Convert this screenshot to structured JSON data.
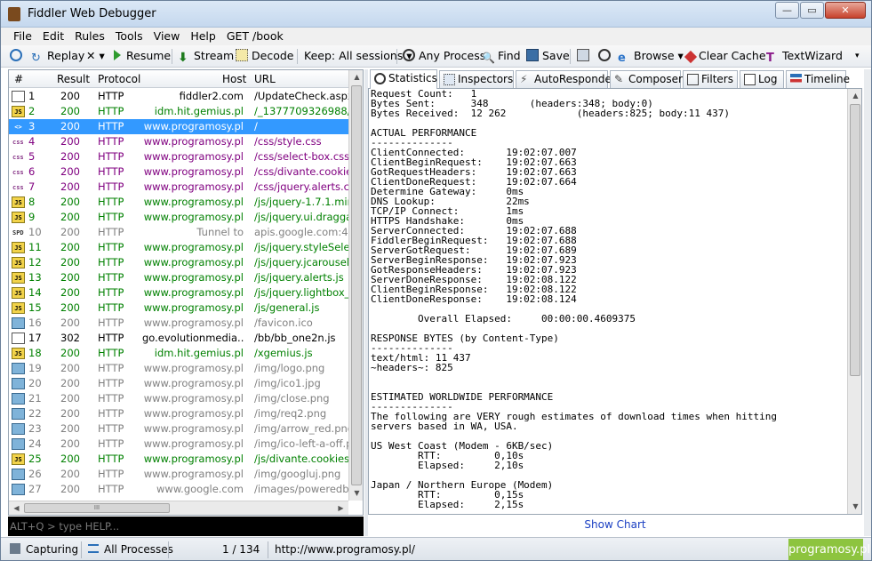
{
  "window": {
    "title": "Fiddler Web Debugger",
    "min_btn": "—",
    "max_btn": "▭",
    "close_btn": "✕"
  },
  "menu": [
    "File",
    "Edit",
    "Rules",
    "Tools",
    "View",
    "Help",
    "GET /book"
  ],
  "toolbar": {
    "comment": "",
    "replay": "Replay",
    "remove": "✕ ▾",
    "resume": "Resume",
    "stream": "Stream",
    "decode": "Decode",
    "keep": "Keep: All sessions ▾",
    "process": "Any Process",
    "find": "Find",
    "save": "Save",
    "browse": "Browse ▾",
    "clear_cache": "Clear Cache",
    "textwizard": "TextWizard"
  },
  "sessions": {
    "headers": {
      "num": "#",
      "result": "Result",
      "protocol": "Protocol",
      "host": "Host",
      "url": "URL"
    },
    "rows": [
      {
        "icon": "doc",
        "num": "1",
        "result": "200",
        "protocol": "HTTP",
        "host": "fiddler2.com",
        "url": "/UpdateCheck.aspx?is",
        "color": "#000000",
        "selected": false
      },
      {
        "icon": "js",
        "num": "2",
        "result": "200",
        "protocol": "HTTP",
        "host": "idm.hit.gemius.pl",
        "url": "/_1377709326988/red",
        "color": "#008000",
        "selected": false
      },
      {
        "icon": "sel",
        "num": "3",
        "result": "200",
        "protocol": "HTTP",
        "host": "www.programosy.pl",
        "url": "/",
        "color": "#ffffff",
        "selected": true
      },
      {
        "icon": "css",
        "num": "4",
        "result": "200",
        "protocol": "HTTP",
        "host": "www.programosy.pl",
        "url": "/css/style.css",
        "color": "#800080",
        "selected": false
      },
      {
        "icon": "css",
        "num": "5",
        "result": "200",
        "protocol": "HTTP",
        "host": "www.programosy.pl",
        "url": "/css/select-box.css",
        "color": "#800080",
        "selected": false
      },
      {
        "icon": "css",
        "num": "6",
        "result": "200",
        "protocol": "HTTP",
        "host": "www.programosy.pl",
        "url": "/css/divante.cookies.r",
        "color": "#800080",
        "selected": false
      },
      {
        "icon": "css",
        "num": "7",
        "result": "200",
        "protocol": "HTTP",
        "host": "www.programosy.pl",
        "url": "/css/jquery.alerts.css",
        "color": "#800080",
        "selected": false
      },
      {
        "icon": "js",
        "num": "8",
        "result": "200",
        "protocol": "HTTP",
        "host": "www.programosy.pl",
        "url": "/js/jquery-1.7.1.min.js",
        "color": "#008000",
        "selected": false
      },
      {
        "icon": "js",
        "num": "9",
        "result": "200",
        "protocol": "HTTP",
        "host": "www.programosy.pl",
        "url": "/js/jquery.ui.draggabl",
        "color": "#008000",
        "selected": false
      },
      {
        "icon": "spdy",
        "num": "10",
        "result": "200",
        "protocol": "HTTP",
        "host": "Tunnel to",
        "url": "apis.google.com:443",
        "color": "#808080",
        "selected": false
      },
      {
        "icon": "js",
        "num": "11",
        "result": "200",
        "protocol": "HTTP",
        "host": "www.programosy.pl",
        "url": "/js/jquery.styleSelect.",
        "color": "#008000",
        "selected": false
      },
      {
        "icon": "js",
        "num": "12",
        "result": "200",
        "protocol": "HTTP",
        "host": "www.programosy.pl",
        "url": "/js/jquery.jcarousel.m",
        "color": "#008000",
        "selected": false
      },
      {
        "icon": "js",
        "num": "13",
        "result": "200",
        "protocol": "HTTP",
        "host": "www.programosy.pl",
        "url": "/js/jquery.alerts.js",
        "color": "#008000",
        "selected": false
      },
      {
        "icon": "js",
        "num": "14",
        "result": "200",
        "protocol": "HTTP",
        "host": "www.programosy.pl",
        "url": "/js/jquery.lightbox_me",
        "color": "#008000",
        "selected": false
      },
      {
        "icon": "js",
        "num": "15",
        "result": "200",
        "protocol": "HTTP",
        "host": "www.programosy.pl",
        "url": "/js/general.js",
        "color": "#008000",
        "selected": false
      },
      {
        "icon": "img",
        "num": "16",
        "result": "200",
        "protocol": "HTTP",
        "host": "www.programosy.pl",
        "url": "/favicon.ico",
        "color": "#808080",
        "selected": false
      },
      {
        "icon": "doc",
        "num": "17",
        "result": "302",
        "protocol": "HTTP",
        "host": "go.evolutionmedia....",
        "url": "/bb/bb_one2n.js",
        "color": "#000000",
        "selected": false
      },
      {
        "icon": "js",
        "num": "18",
        "result": "200",
        "protocol": "HTTP",
        "host": "idm.hit.gemius.pl",
        "url": "/xgemius.js",
        "color": "#008000",
        "selected": false
      },
      {
        "icon": "img",
        "num": "19",
        "result": "200",
        "protocol": "HTTP",
        "host": "www.programosy.pl",
        "url": "/img/logo.png",
        "color": "#808080",
        "selected": false
      },
      {
        "icon": "img",
        "num": "20",
        "result": "200",
        "protocol": "HTTP",
        "host": "www.programosy.pl",
        "url": "/img/ico1.jpg",
        "color": "#808080",
        "selected": false
      },
      {
        "icon": "img",
        "num": "21",
        "result": "200",
        "protocol": "HTTP",
        "host": "www.programosy.pl",
        "url": "/img/close.png",
        "color": "#808080",
        "selected": false
      },
      {
        "icon": "img",
        "num": "22",
        "result": "200",
        "protocol": "HTTP",
        "host": "www.programosy.pl",
        "url": "/img/req2.png",
        "color": "#808080",
        "selected": false
      },
      {
        "icon": "img",
        "num": "23",
        "result": "200",
        "protocol": "HTTP",
        "host": "www.programosy.pl",
        "url": "/img/arrow_red.png",
        "color": "#808080",
        "selected": false
      },
      {
        "icon": "img",
        "num": "24",
        "result": "200",
        "protocol": "HTTP",
        "host": "www.programosy.pl",
        "url": "/img/ico-left-a-off.png",
        "color": "#808080",
        "selected": false
      },
      {
        "icon": "js",
        "num": "25",
        "result": "200",
        "protocol": "HTTP",
        "host": "www.programosy.pl",
        "url": "/js/divante.cookies.mi",
        "color": "#008000",
        "selected": false
      },
      {
        "icon": "img",
        "num": "26",
        "result": "200",
        "protocol": "HTTP",
        "host": "www.programosy.pl",
        "url": "/img/googluj.png",
        "color": "#808080",
        "selected": false
      },
      {
        "icon": "img",
        "num": "27",
        "result": "200",
        "protocol": "HTTP",
        "host": "www.google.com",
        "url": "/images/poweredby_t",
        "color": "#808080",
        "selected": false
      }
    ],
    "hscroll_label": "III"
  },
  "quickexec": {
    "placeholder": "ALT+Q > type HELP..."
  },
  "tabs": [
    "Statistics",
    "Inspectors",
    "AutoResponder",
    "Composer",
    "Filters",
    "Log",
    "Timeline"
  ],
  "statistics": [
    "Request Count:   1",
    "Bytes Sent:      348       (headers:348; body:0)",
    "Bytes Received:  12 262            (headers:825; body:11 437)",
    "",
    "ACTUAL PERFORMANCE",
    "--------------",
    "ClientConnected:       19:02:07.007",
    "ClientBeginRequest:    19:02:07.663",
    "GotRequestHeaders:     19:02:07.663",
    "ClientDoneRequest:     19:02:07.664",
    "Determine Gateway:     0ms",
    "DNS Lookup:            22ms",
    "TCP/IP Connect:        1ms",
    "HTTPS Handshake:       0ms",
    "ServerConnected:       19:02:07.688",
    "FiddlerBeginRequest:   19:02:07.688",
    "ServerGotRequest:      19:02:07.689",
    "ServerBeginResponse:   19:02:07.923",
    "GotResponseHeaders:    19:02:07.923",
    "ServerDoneResponse:    19:02:08.122",
    "ClientBeginResponse:   19:02:08.122",
    "ClientDoneResponse:    19:02:08.124",
    "",
    "        Overall Elapsed:     00:00:00.4609375",
    "",
    "RESPONSE BYTES (by Content-Type)",
    "--------------",
    "text/html: 11 437",
    "~headers~: 825",
    "",
    "",
    "ESTIMATED WORLDWIDE PERFORMANCE",
    "--------------",
    "The following are VERY rough estimates of download times when hitting",
    "servers based in WA, USA.",
    "",
    "US West Coast (Modem - 6KB/sec)",
    "        RTT:         0,10s",
    "        Elapsed:     2,10s",
    "",
    "Japan / Northern Europe (Modem)",
    "        RTT:         0,15s",
    "        Elapsed:     2,15s"
  ],
  "show_chart": "Show Chart",
  "status": {
    "capturing": "Capturing",
    "processes": "All Processes",
    "count": "1 / 134",
    "url": "http://www.programosy.pl/",
    "brand": "programosy.pl"
  }
}
